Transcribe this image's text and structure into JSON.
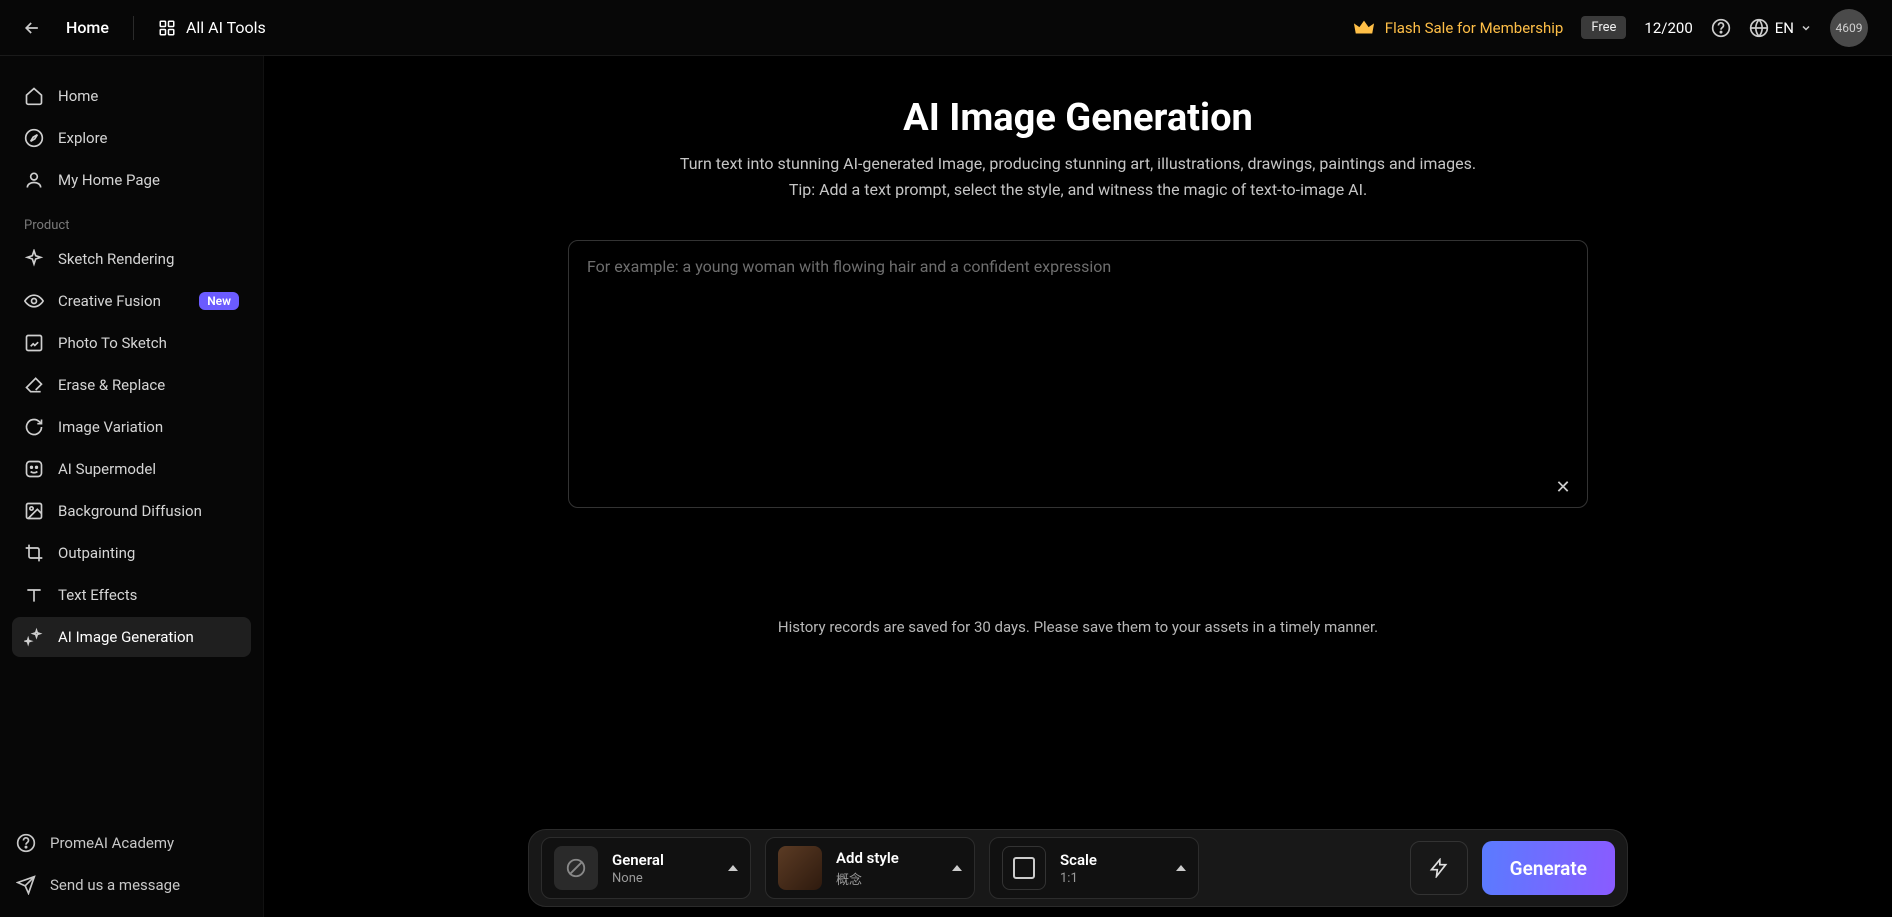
{
  "topbar": {
    "home": "Home",
    "all_tools": "All AI Tools",
    "flash_sale": "Flash Sale for Membership",
    "free_label": "Free",
    "credits": "12/200",
    "lang": "EN",
    "avatar_label": "4609"
  },
  "sidebar": {
    "nav": [
      {
        "label": "Home",
        "icon": "home-icon"
      },
      {
        "label": "Explore",
        "icon": "compass-icon"
      },
      {
        "label": "My Home Page",
        "icon": "user-icon"
      }
    ],
    "section_label": "Product",
    "products": [
      {
        "label": "Sketch Rendering",
        "icon": "sparkle-icon"
      },
      {
        "label": "Creative Fusion",
        "icon": "eye-icon",
        "badge": "New"
      },
      {
        "label": "Photo To Sketch",
        "icon": "edit-icon"
      },
      {
        "label": "Erase & Replace",
        "icon": "eraser-icon"
      },
      {
        "label": "Image Variation",
        "icon": "refresh-icon"
      },
      {
        "label": "AI Supermodel",
        "icon": "face-icon"
      },
      {
        "label": "Background Diffusion",
        "icon": "image-icon"
      },
      {
        "label": "Outpainting",
        "icon": "crop-icon"
      },
      {
        "label": "Text Effects",
        "icon": "text-icon"
      },
      {
        "label": "AI Image Generation",
        "icon": "magic-icon",
        "active": true
      }
    ],
    "footer": [
      {
        "label": "PromeAI Academy",
        "icon": "help-icon"
      },
      {
        "label": "Send us a message",
        "icon": "send-icon"
      }
    ]
  },
  "hero": {
    "title": "AI Image Generation",
    "line1": "Turn text into stunning AI-generated Image, producing stunning art, illustrations, drawings, paintings and images.",
    "line2": "Tip: Add a text prompt, select the style, and witness the magic of text-to-image AI."
  },
  "prompt": {
    "placeholder": "For example: a young woman with flowing hair and a confident expression",
    "value": ""
  },
  "history_note": "History records are saved for 30 days. Please save them to your assets in a timely manner.",
  "options": {
    "general": {
      "title": "General",
      "sub": "None"
    },
    "style": {
      "title": "Add style",
      "sub": "概念"
    },
    "scale": {
      "title": "Scale",
      "sub": "1:1"
    },
    "generate_label": "Generate"
  }
}
